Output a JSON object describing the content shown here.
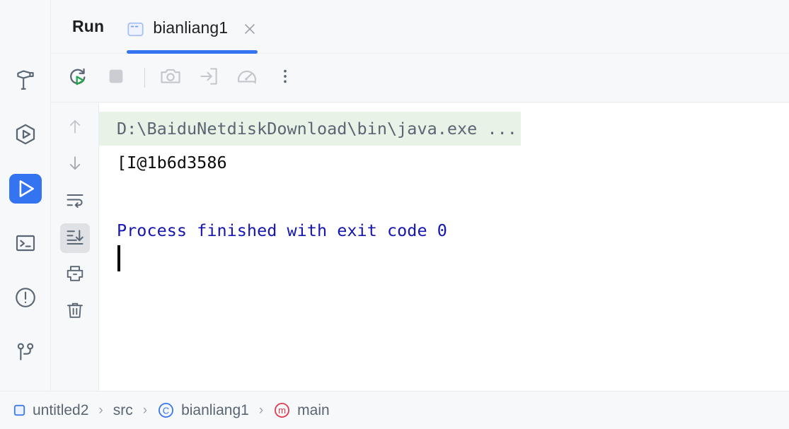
{
  "window": {
    "title": "Run"
  },
  "tool_window_bar": {
    "items": [
      {
        "name": "build",
        "icon": "hammer-icon",
        "selected": false
      },
      {
        "name": "services",
        "icon": "services-play-hexagon-icon",
        "selected": false
      },
      {
        "name": "run",
        "icon": "run-play-icon",
        "selected": true
      },
      {
        "name": "terminal",
        "icon": "terminal-icon",
        "selected": false
      },
      {
        "name": "problems",
        "icon": "problems-exclamation-icon",
        "selected": false
      },
      {
        "name": "git",
        "icon": "git-branch-icon",
        "selected": false
      }
    ]
  },
  "run_header": {
    "title": "Run",
    "tab": {
      "label": "bianliang1",
      "icon": "console-window-icon",
      "close_icon": "close-icon",
      "active": true,
      "accent_color": "#3574f0"
    }
  },
  "console_toolbar": {
    "buttons": [
      {
        "name": "rerun",
        "icon": "rerun-circular-arrow-play-icon",
        "label": "Rerun"
      },
      {
        "name": "stop",
        "icon": "stop-square-icon",
        "label": "Stop"
      },
      {
        "name": "screenshot",
        "icon": "camera-icon",
        "label": "Take Screenshot"
      },
      {
        "name": "export",
        "icon": "arrow-into-box-icon",
        "label": "Export"
      },
      {
        "name": "profiler",
        "icon": "gauge-icon",
        "label": "Profiler"
      },
      {
        "name": "more",
        "icon": "more-vertical-dots-icon",
        "label": "More"
      }
    ]
  },
  "console_gutter": {
    "buttons": [
      {
        "name": "up",
        "icon": "arrow-up-icon",
        "label": "Previous Occurrence",
        "selected": false
      },
      {
        "name": "down",
        "icon": "arrow-down-icon",
        "label": "Next Occurrence",
        "selected": false
      },
      {
        "name": "soft-wrap",
        "icon": "soft-wrap-icon",
        "label": "Soft-Wrap",
        "selected": false
      },
      {
        "name": "scroll-to-end",
        "icon": "scroll-to-end-icon",
        "label": "Scroll to End",
        "selected": true
      },
      {
        "name": "print",
        "icon": "printer-icon",
        "label": "Print",
        "selected": false
      },
      {
        "name": "clear-all",
        "icon": "trash-icon",
        "label": "Clear All",
        "selected": false
      }
    ]
  },
  "console": {
    "lines": [
      {
        "text": "D:\\BaiduNetdiskDownload\\bin\\java.exe ...",
        "kind": "cmd"
      },
      {
        "text": "[I@1b6d3586",
        "kind": "out"
      },
      {
        "text": "",
        "kind": "blank"
      },
      {
        "text": "Process finished with exit code 0",
        "kind": "status"
      }
    ],
    "command_line": "D:\\BaiduNetdiskDownload\\bin\\java.exe ...",
    "output_line": "[I@1b6d3586",
    "status_line": "Process finished with exit code 0",
    "cmd_highlight_color": "#e9f2e6",
    "status_color": "#1616b0",
    "caret_visible": true
  },
  "breadcrumb": {
    "separator": "›",
    "items": [
      {
        "label": "untitled2",
        "icon": "module-square-icon",
        "icon_color": "#3574f0"
      },
      {
        "label": "src",
        "icon": "none",
        "icon_color": ""
      },
      {
        "label": "bianliang1",
        "icon": "class-c-icon",
        "icon_color": "#3574f0"
      },
      {
        "label": "main",
        "icon": "method-m-icon",
        "icon_color": "#e0384a"
      }
    ]
  }
}
